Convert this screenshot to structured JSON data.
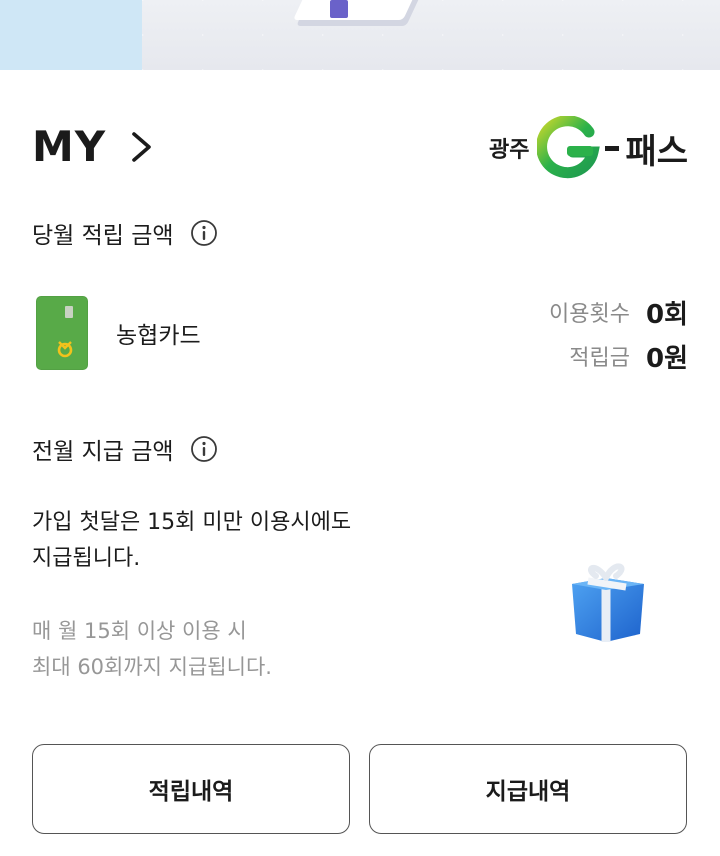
{
  "header": {
    "title": "MY",
    "logo": {
      "region": "광주",
      "pass": "패스"
    }
  },
  "current_month": {
    "label": "당월 적립 금액",
    "card_name": "농협카드",
    "stats": [
      {
        "label": "이용횟수",
        "value": "0회"
      },
      {
        "label": "적립금",
        "value": "0원"
      }
    ]
  },
  "previous_month": {
    "label": "전월 지급 금액",
    "description_line1": "가입 첫달은 15회 미만 이용시에도",
    "description_line2": "지급됩니다.",
    "note_line1": "매 월 15회 이상 이용 시",
    "note_line2": "최대 60회까지 지급됩니다."
  },
  "buttons": {
    "accrual_history": "적립내역",
    "payment_history": "지급내역"
  },
  "colors": {
    "card_green": "#58aa48",
    "logo_green": "#2bb14a",
    "logo_yellow": "#c5d72c",
    "gift_blue": "#2f7ee0"
  }
}
